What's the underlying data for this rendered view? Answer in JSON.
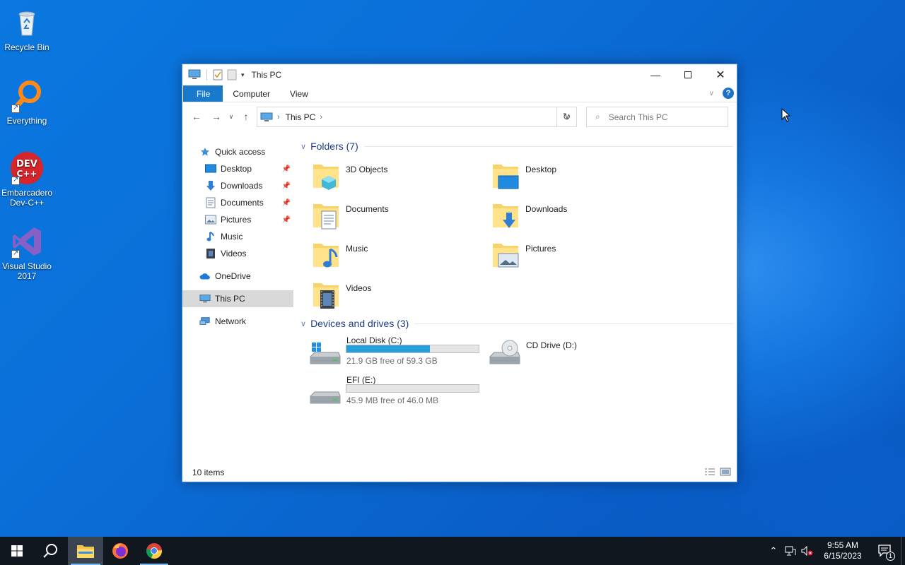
{
  "desktop": {
    "icons": [
      {
        "label": "Recycle Bin",
        "icon": "recycle-bin-icon"
      },
      {
        "label": "Everything",
        "icon": "everything-search-icon"
      },
      {
        "label": "Embarcadero Dev-C++",
        "icon": "devcpp-icon",
        "badge": "DEV C++"
      },
      {
        "label": "Visual Studio 2017",
        "icon": "visual-studio-icon"
      }
    ]
  },
  "window": {
    "title": "This PC",
    "ribbon": {
      "tabs": [
        "File",
        "Computer",
        "View"
      ],
      "help_label": "?"
    },
    "address": {
      "crumb": "This PC",
      "search_placeholder": "Search This PC"
    },
    "nav": {
      "quick_access": "Quick access",
      "pinned": [
        {
          "label": "Desktop",
          "icon": "desktop-icon",
          "pinned": true
        },
        {
          "label": "Downloads",
          "icon": "downloads-icon",
          "pinned": true
        },
        {
          "label": "Documents",
          "icon": "documents-icon",
          "pinned": true
        },
        {
          "label": "Pictures",
          "icon": "pictures-icon",
          "pinned": true
        },
        {
          "label": "Music",
          "icon": "music-icon",
          "pinned": false
        },
        {
          "label": "Videos",
          "icon": "videos-icon",
          "pinned": false
        }
      ],
      "onedrive": "OneDrive",
      "this_pc": "This PC",
      "network": "Network"
    },
    "folders": {
      "header": "Folders (7)",
      "items": [
        "3D Objects",
        "Desktop",
        "Documents",
        "Downloads",
        "Music",
        "Pictures",
        "Videos"
      ]
    },
    "drives": {
      "header": "Devices and drives (3)",
      "items": [
        {
          "name": "Local Disk (C:)",
          "free": "21.9 GB free of 59.3 GB",
          "used_fraction": 0.63
        },
        {
          "name": "CD Drive (D:)"
        },
        {
          "name": "EFI (E:)",
          "free": "45.9 MB free of 46.0 MB",
          "used_fraction": 0.0
        }
      ]
    },
    "status": "10 items"
  },
  "taskbar": {
    "time": "9:55 AM",
    "date": "6/15/2023",
    "notification_count": "1"
  },
  "colors": {
    "accent": "#1979ca",
    "drive_fill": "#26a0da",
    "taskbar": "#10171f"
  }
}
